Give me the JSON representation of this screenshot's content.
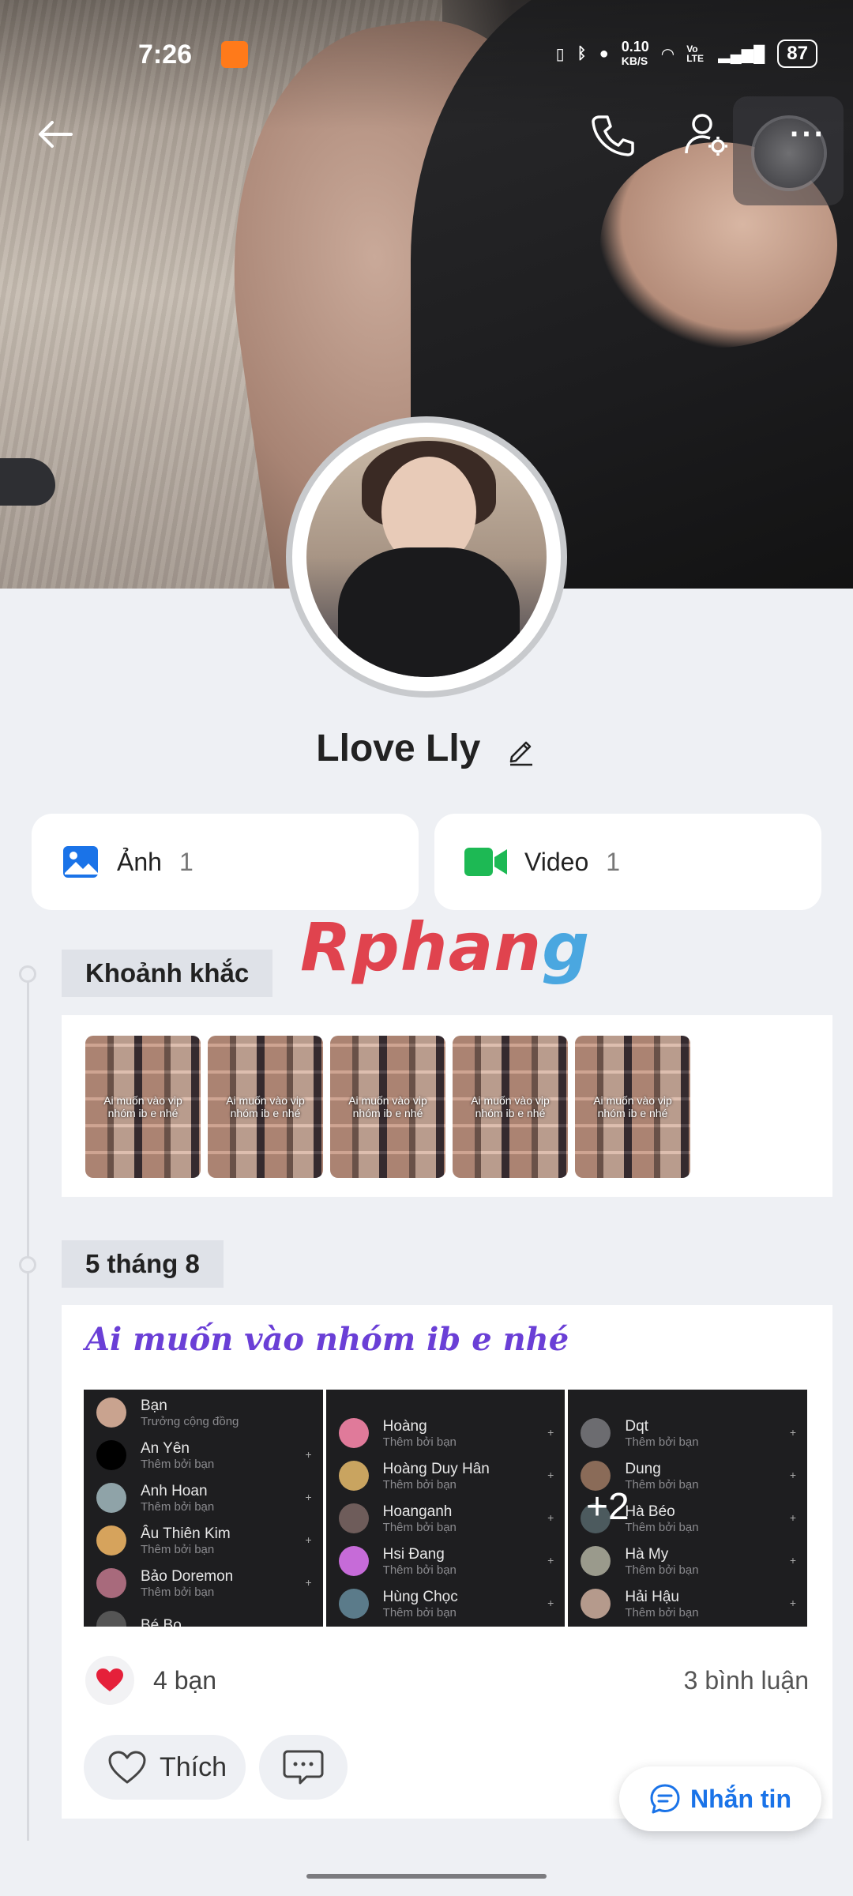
{
  "status_bar": {
    "time": "7:26",
    "net_speed_top": "0.10",
    "net_speed_unit": "KB/S",
    "volte": "Vo LTE",
    "battery": "87"
  },
  "profile": {
    "name": "Llove Lly"
  },
  "albums": [
    {
      "label": "Ảnh",
      "count": "1"
    },
    {
      "label": "Video",
      "count": "1"
    }
  ],
  "watermark": {
    "part1": "Rphan",
    "part2": "g"
  },
  "moments": {
    "tag": "Khoảnh khắc",
    "thumbs": [
      {
        "caption": "Ai muốn vào vip nhóm ib e nhé"
      },
      {
        "caption": "Ai muốn vào vip nhóm ib e nhé"
      },
      {
        "caption": "Ai muốn vào vip nhóm ib e nhé"
      },
      {
        "caption": "Ai muốn vào vip nhóm ib e nhé"
      },
      {
        "caption": "Ai muốn vào vip nhóm ib e nhé"
      }
    ]
  },
  "post": {
    "date_tag": "5 tháng 8",
    "title": "Ai muốn vào nhóm ib e nhé",
    "screens": [
      [
        {
          "name": "Bạn",
          "sub": "Trưởng cộng đồng"
        },
        {
          "name": "An Yên",
          "sub": "Thêm bởi bạn"
        },
        {
          "name": "Anh Hoan",
          "sub": "Thêm bởi bạn"
        },
        {
          "name": "Âu Thiên Kim",
          "sub": "Thêm bởi bạn"
        },
        {
          "name": "Bảo Doremon",
          "sub": "Thêm bởi bạn"
        },
        {
          "name": "Bé Bo",
          "sub": ""
        }
      ],
      [
        {
          "name": "Hoàng",
          "sub": "Thêm bởi bạn"
        },
        {
          "name": "Hoàng Duy Hân",
          "sub": "Thêm bởi bạn"
        },
        {
          "name": "Hoanganh",
          "sub": "Thêm bởi bạn"
        },
        {
          "name": "Hsi Đang",
          "sub": "Thêm bởi bạn"
        },
        {
          "name": "Hùng Chọc",
          "sub": "Thêm bởi bạn"
        }
      ],
      [
        {
          "name": "Dqt",
          "sub": "Thêm bởi bạn"
        },
        {
          "name": "Dung",
          "sub": "Thêm bởi bạn"
        },
        {
          "name": "Hà Béo",
          "sub": "Thêm bởi bạn"
        },
        {
          "name": "Hà My",
          "sub": "Thêm bởi bạn"
        },
        {
          "name": "Hải Hậu",
          "sub": "Thêm bởi bạn"
        }
      ]
    ],
    "more_count": "+2",
    "reactions_text": "4 bạn",
    "comments_text": "3 bình luận",
    "like_label": "Thích"
  },
  "message_button": {
    "label": "Nhắn tin"
  },
  "colors": {
    "accent": "#1a73e8",
    "video_green": "#1db954",
    "photo_blue": "#1a73e8",
    "post_title": "#6a3fd6"
  }
}
